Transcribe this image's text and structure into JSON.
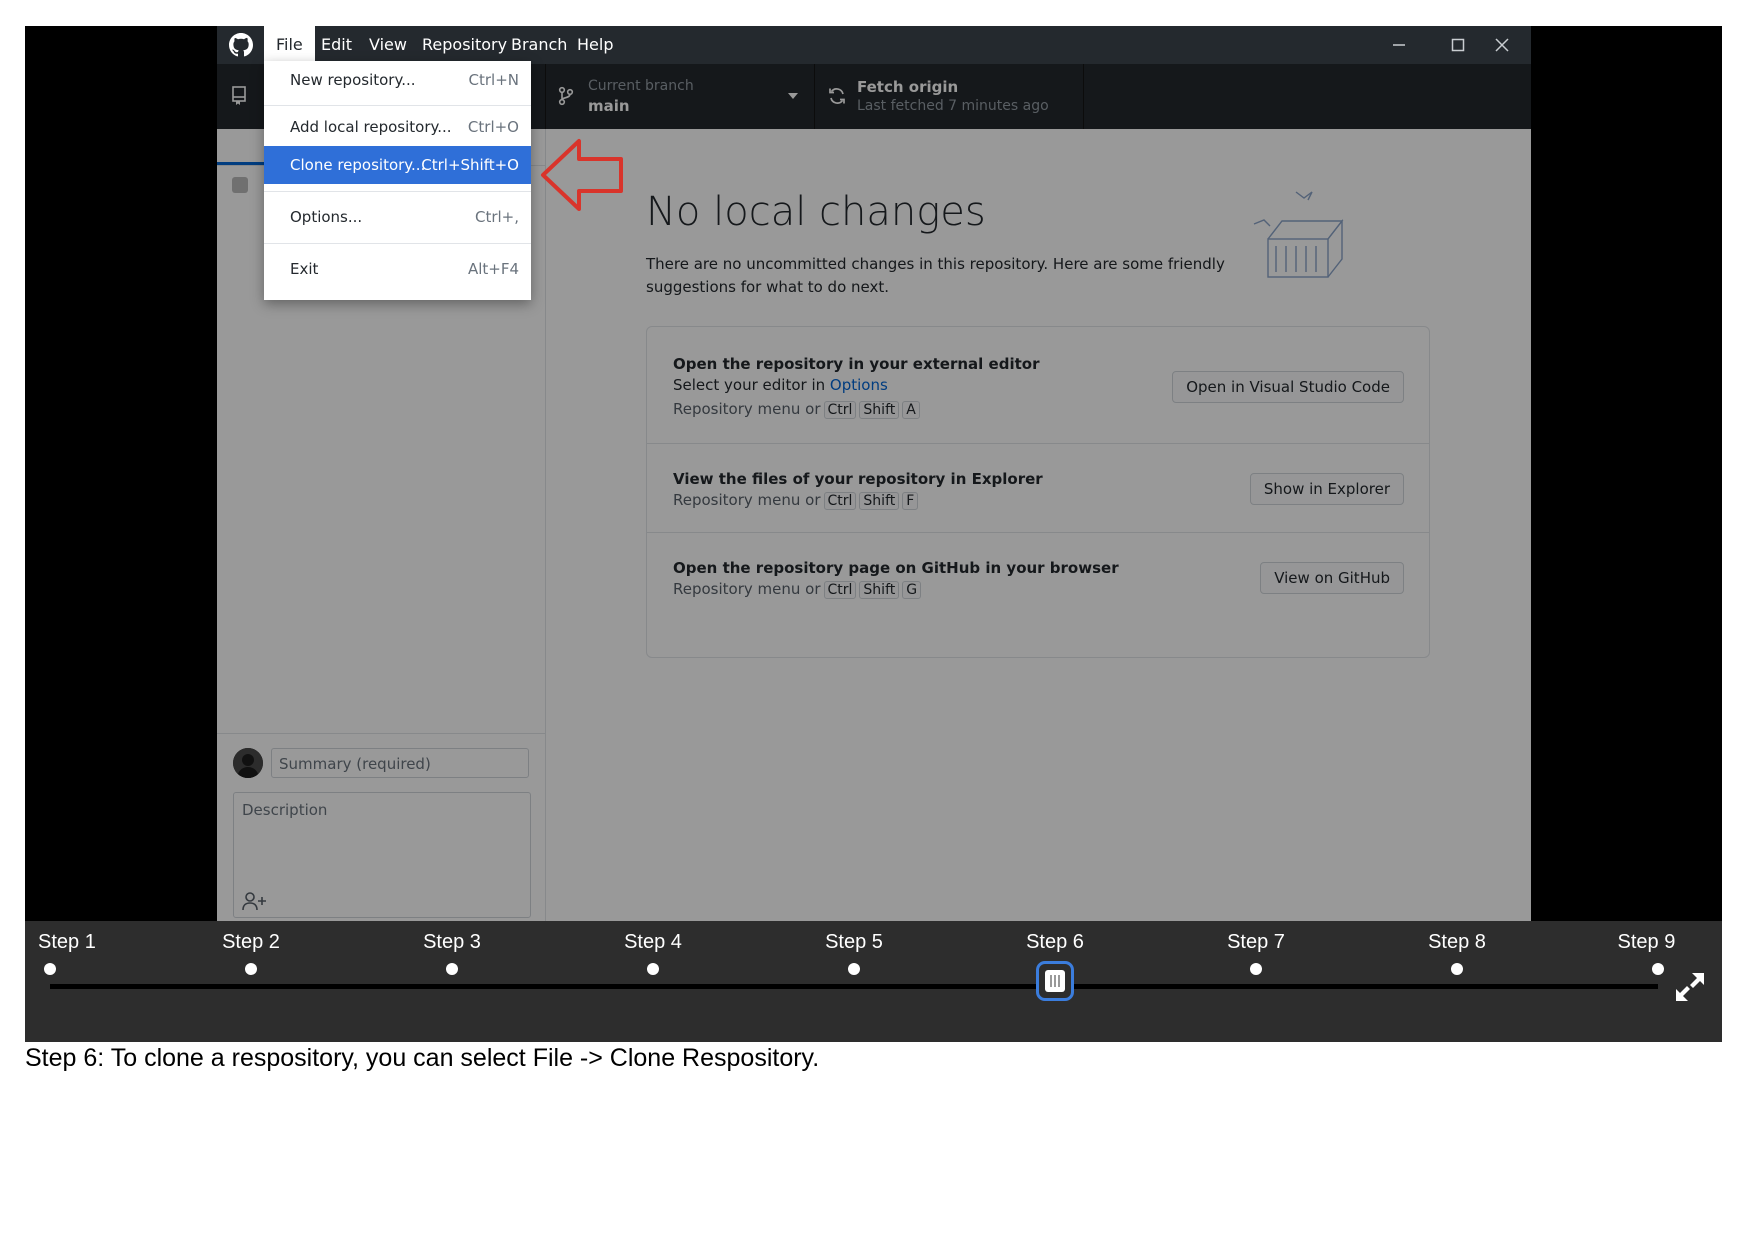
{
  "menubar": {
    "items": [
      "File",
      "Edit",
      "View",
      "Repository",
      "Branch",
      "Help"
    ],
    "active": "File"
  },
  "toolbar": {
    "branch_sub": "Current branch",
    "branch_main": "main",
    "fetch_main": "Fetch origin",
    "fetch_sub": "Last fetched 7 minutes ago"
  },
  "file_menu": {
    "items": [
      {
        "label": "New repository...",
        "shortcut": "Ctrl+N"
      },
      {
        "label": "Add local repository...",
        "shortcut": "Ctrl+O"
      },
      {
        "label": "Clone repository...",
        "shortcut": "Ctrl+Shift+O"
      },
      {
        "label": "Options...",
        "shortcut": "Ctrl+,"
      },
      {
        "label": "Exit",
        "shortcut": "Alt+F4"
      }
    ],
    "highlighted": "Clone repository..."
  },
  "main": {
    "title": "No local changes",
    "description": "There are no uncommitted changes in this repository. Here are some friendly suggestions for what to do next.",
    "suggestions": [
      {
        "title": "Open the repository in your external editor",
        "sub_prefix": "Select your editor in ",
        "sub_link": "Options",
        "menu_text": "Repository menu or",
        "keys": [
          "Ctrl",
          "Shift",
          "A"
        ],
        "button": "Open in Visual Studio Code"
      },
      {
        "title": "View the files of your repository in Explorer",
        "menu_text": "Repository menu or",
        "keys": [
          "Ctrl",
          "Shift",
          "F"
        ],
        "button": "Show in Explorer"
      },
      {
        "title": "Open the repository page on GitHub in your browser",
        "menu_text": "Repository menu or",
        "keys": [
          "Ctrl",
          "Shift",
          "G"
        ],
        "button": "View on GitHub"
      }
    ]
  },
  "commit": {
    "summary_placeholder": "Summary (required)",
    "description_placeholder": "Description"
  },
  "steps": {
    "labels": [
      "Step 1",
      "Step 2",
      "Step 3",
      "Step 4",
      "Step 5",
      "Step 6",
      "Step 7",
      "Step 8",
      "Step 9"
    ],
    "current": 6
  },
  "caption": "Step 6: To clone a respository, you can select File -> Clone Respository.",
  "colors": {
    "highlight": "#2f6fd8",
    "arrow": "#d9342b",
    "thumb_border": "#3b7ddd"
  }
}
